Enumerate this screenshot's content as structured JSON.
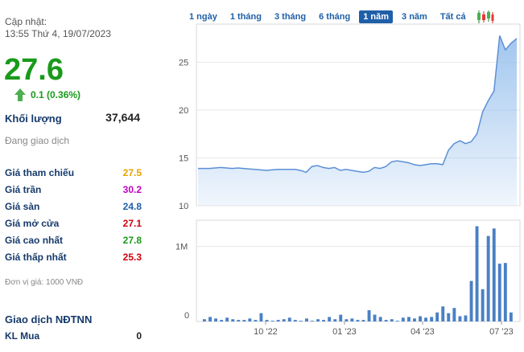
{
  "update": {
    "label": "Cập nhật:",
    "time": "13:55 Thứ 4, 19/07/2023"
  },
  "price": {
    "value": "27.6",
    "change": "0.1 (0.36%)",
    "up_color": "#1a9a1a"
  },
  "volume": {
    "label": "Khối lượng",
    "value": "37,644"
  },
  "status": "Đang giao dịch",
  "stats": [
    {
      "label": "Giá tham chiếu",
      "value": "27.5",
      "color": "#e8a200"
    },
    {
      "label": "Giá trần",
      "value": "30.2",
      "color": "#c000c0"
    },
    {
      "label": "Giá sàn",
      "value": "24.8",
      "color": "#1f5fa8"
    },
    {
      "label": "Giá mở cửa",
      "value": "27.1",
      "color": "#d0000d"
    },
    {
      "label": "Giá cao nhất",
      "value": "27.8",
      "color": "#1a9a1a"
    },
    {
      "label": "Giá thấp nhất",
      "value": "25.3",
      "color": "#d0000d"
    }
  ],
  "unit": "Đơn vị giá: 1000 VNĐ",
  "foreign": {
    "title": "Giao dịch NĐTNN",
    "buy_label": "KL Mua",
    "buy_value": "0"
  },
  "ranges": [
    "1 ngày",
    "1 tháng",
    "3 tháng",
    "6 tháng",
    "1 năm",
    "3 năm",
    "Tất cả"
  ],
  "active_range": "1 năm",
  "chart_data": {
    "type": "area",
    "x_ticks": [
      "10 '22",
      "01 '23",
      "04 '23",
      "07 '23"
    ],
    "price": {
      "y_ticks": [
        10,
        15,
        20,
        25
      ],
      "ylim": [
        10,
        29
      ],
      "values": [
        13.9,
        13.9,
        13.9,
        13.95,
        14.0,
        13.95,
        13.9,
        13.95,
        13.9,
        13.85,
        13.8,
        13.75,
        13.7,
        13.75,
        13.8,
        13.8,
        13.8,
        13.8,
        13.7,
        13.5,
        14.1,
        14.2,
        14.0,
        13.9,
        14.0,
        13.7,
        13.8,
        13.7,
        13.6,
        13.5,
        13.6,
        14.0,
        13.9,
        14.1,
        14.6,
        14.7,
        14.6,
        14.5,
        14.3,
        14.2,
        14.3,
        14.4,
        14.4,
        14.3,
        15.8,
        16.5,
        16.8,
        16.5,
        16.7,
        17.5,
        19.8,
        21.0,
        22.0,
        27.8,
        26.3,
        27.0,
        27.5
      ],
      "line_color": "#5b8fd6",
      "fill_color": "#9cc3ee"
    },
    "volume": {
      "y_ticks": [
        "0",
        "1M"
      ],
      "ylim": [
        0,
        1350000
      ],
      "values": [
        30000,
        60000,
        40000,
        20000,
        50000,
        30000,
        20000,
        20000,
        40000,
        20000,
        110000,
        20000,
        10000,
        20000,
        30000,
        50000,
        20000,
        10000,
        40000,
        10000,
        30000,
        20000,
        60000,
        30000,
        90000,
        30000,
        40000,
        20000,
        20000,
        150000,
        90000,
        60000,
        20000,
        30000,
        10000,
        50000,
        60000,
        40000,
        70000,
        50000,
        60000,
        120000,
        200000,
        110000,
        180000,
        70000,
        80000,
        540000,
        1270000,
        430000,
        1140000,
        1240000,
        770000,
        780000,
        120000
      ],
      "bar_color": "#4a80c4"
    }
  }
}
